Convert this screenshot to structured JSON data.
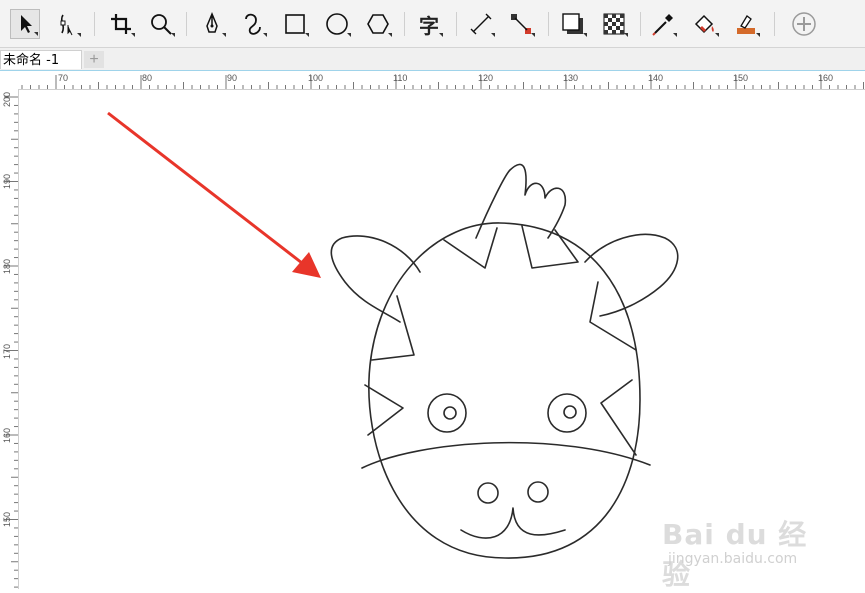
{
  "toolbar": {
    "text_tool_glyph": "字",
    "tools": [
      {
        "name": "pick-tool",
        "icon": "arrow-cursor-icon",
        "active": true
      },
      {
        "name": "shape-tool",
        "icon": "node-edit-icon"
      },
      {
        "name": "crop-tool",
        "icon": "crop-icon"
      },
      {
        "name": "zoom-tool",
        "icon": "magnifier-icon"
      },
      {
        "name": "pen-tool",
        "icon": "pen-nib-icon"
      },
      {
        "name": "artistic-media-tool",
        "icon": "curve-icon"
      },
      {
        "name": "rectangle-tool",
        "icon": "rectangle-icon"
      },
      {
        "name": "ellipse-tool",
        "icon": "ellipse-icon"
      },
      {
        "name": "polygon-tool",
        "icon": "hexagon-icon"
      },
      {
        "name": "text-tool",
        "icon": "text-icon"
      },
      {
        "name": "dimension-tool",
        "icon": "dimension-line-icon"
      },
      {
        "name": "connector-tool",
        "icon": "connector-icon"
      },
      {
        "name": "drop-shadow-tool",
        "icon": "drop-shadow-icon"
      },
      {
        "name": "transparency-tool",
        "icon": "checkerboard-icon"
      },
      {
        "name": "eyedropper-tool",
        "icon": "eyedropper-icon"
      },
      {
        "name": "interactive-fill-tool",
        "icon": "paint-bucket-icon"
      },
      {
        "name": "smart-fill-tool",
        "icon": "smart-fill-icon"
      },
      {
        "name": "add-tool",
        "icon": "plus-circle-icon"
      }
    ]
  },
  "tabs": {
    "document_title": "未命名 -1",
    "add_tab_label": "+"
  },
  "ruler": {
    "top_labels": [
      "70",
      "80",
      "90",
      "100",
      "110",
      "120",
      "130",
      "140",
      "150",
      "160"
    ],
    "left_labels": [
      "200",
      "190",
      "180",
      "170",
      "160",
      "150"
    ]
  },
  "watermark": {
    "brand": "Bai du 经验",
    "url": "jingyan.baidu.com"
  },
  "colors": {
    "arrow": "#e8352a",
    "stroke": "#2b2b2b",
    "accent": "#9fd3ea"
  }
}
